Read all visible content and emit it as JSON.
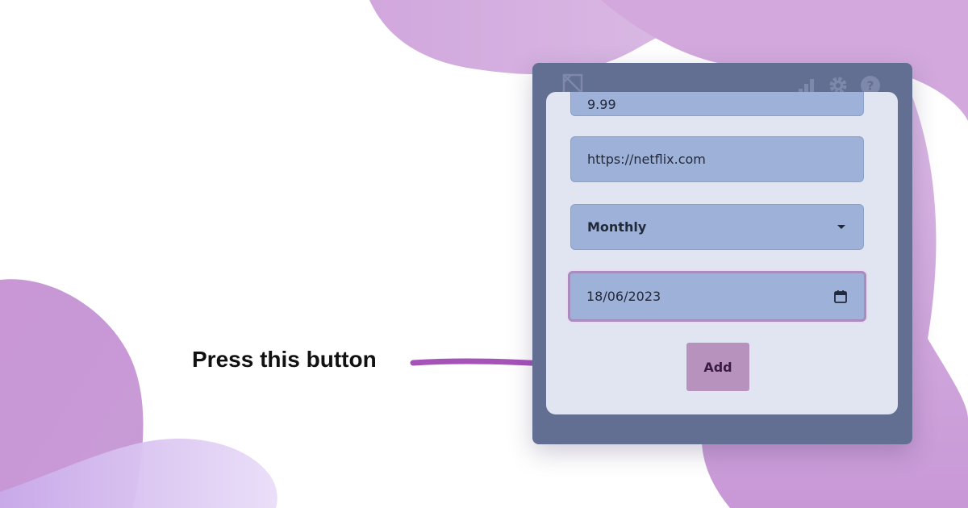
{
  "caption": "Press this button",
  "form": {
    "price_value": "9.99",
    "url_value": "https://netflix.com",
    "frequency_selected": "Monthly",
    "date_value": "18/06/2023",
    "add_label": "Add"
  },
  "icons": {
    "logo": "subscription-logo-icon",
    "stats": "bar-chart-icon",
    "settings": "gear-icon",
    "help": "help-icon",
    "dropdown": "chevron-down-icon",
    "calendar": "calendar-icon"
  },
  "colors": {
    "popup_frame": "#636e93",
    "card": "#e1e5f2",
    "field": "#9eb1d9",
    "focus_ring": "#a98bc0",
    "add_button": "#b792bd",
    "arrow": "#a553b9",
    "blob": "#c999d6"
  }
}
